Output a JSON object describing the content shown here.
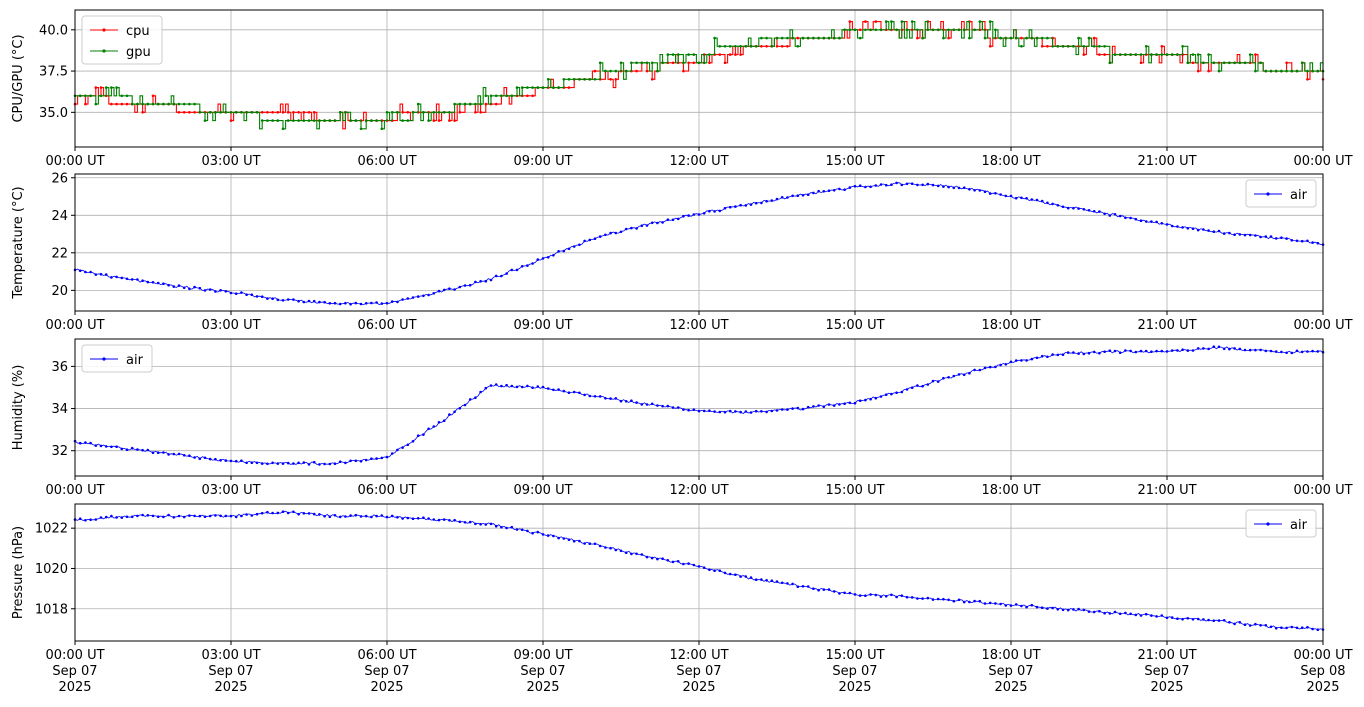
{
  "chart_data": [
    {
      "type": "line",
      "ylabel": "CPU/GPU (°C)",
      "xlabel": "",
      "xlim": [
        "2025-09-07T00:00:00Z",
        "2025-09-08T00:00:00Z"
      ],
      "ylim": [
        32.9,
        41.2
      ],
      "yticks": [
        35.0,
        37.5,
        40.0
      ],
      "ytick_labels": [
        "35.0",
        "37.5",
        "40.0"
      ],
      "xtick_labels": [
        "00:00 UT",
        "03:00 UT",
        "06:00 UT",
        "09:00 UT",
        "12:00 UT",
        "15:00 UT",
        "18:00 UT",
        "21:00 UT",
        "00:00 UT"
      ],
      "grid": true,
      "legend_position": "upper-left",
      "series": [
        {
          "name": "cpu",
          "color": "#ff0000",
          "x_hours": [
            0,
            1,
            2,
            3,
            4,
            5,
            6,
            7,
            8,
            9,
            10,
            11,
            12,
            13,
            14,
            15,
            16,
            17,
            18,
            19,
            20,
            21,
            22,
            23,
            24
          ],
          "y": [
            36.0,
            35.6,
            35.2,
            35.0,
            34.8,
            34.7,
            34.7,
            35.0,
            35.6,
            36.4,
            37.0,
            37.6,
            38.2,
            38.9,
            39.4,
            39.8,
            40.0,
            39.9,
            39.6,
            39.0,
            38.6,
            38.4,
            38.0,
            37.7,
            37.4
          ]
        },
        {
          "name": "gpu",
          "color": "#008000",
          "x_hours": [
            0,
            1,
            2,
            3,
            4,
            5,
            6,
            7,
            8,
            9,
            10,
            11,
            12,
            13,
            14,
            15,
            16,
            17,
            18,
            19,
            20,
            21,
            22,
            23,
            24
          ],
          "y": [
            36.2,
            35.8,
            35.4,
            35.0,
            34.5,
            34.4,
            34.5,
            35.0,
            35.9,
            36.5,
            37.2,
            38.0,
            38.6,
            39.2,
            39.6,
            39.8,
            40.1,
            40.0,
            39.6,
            39.1,
            38.7,
            38.5,
            38.1,
            37.7,
            37.5
          ]
        }
      ]
    },
    {
      "type": "line",
      "ylabel": "Temperature (°C)",
      "xlabel": "",
      "xlim": [
        "2025-09-07T00:00:00Z",
        "2025-09-08T00:00:00Z"
      ],
      "ylim": [
        18.9,
        26.2
      ],
      "yticks": [
        20,
        22,
        24,
        26
      ],
      "ytick_labels": [
        "20",
        "22",
        "24",
        "26"
      ],
      "xtick_labels": [
        "00:00 UT",
        "03:00 UT",
        "06:00 UT",
        "09:00 UT",
        "12:00 UT",
        "15:00 UT",
        "18:00 UT",
        "21:00 UT",
        "00:00 UT"
      ],
      "grid": true,
      "legend_position": "upper-right",
      "series": [
        {
          "name": "air",
          "color": "#0000ff",
          "x_hours": [
            0,
            1,
            2,
            3,
            4,
            5,
            6,
            7,
            8,
            9,
            10,
            11,
            12,
            13,
            14,
            15,
            16,
            17,
            18,
            19,
            20,
            21,
            22,
            23,
            24
          ],
          "y": [
            21.1,
            20.6,
            20.2,
            19.9,
            19.5,
            19.3,
            19.3,
            19.9,
            20.6,
            21.7,
            22.8,
            23.5,
            24.1,
            24.6,
            25.1,
            25.5,
            25.7,
            25.5,
            25.0,
            24.5,
            24.0,
            23.5,
            23.1,
            22.8,
            22.5
          ]
        }
      ]
    },
    {
      "type": "line",
      "ylabel": "Humidity (%)",
      "xlabel": "",
      "xlim": [
        "2025-09-07T00:00:00Z",
        "2025-09-08T00:00:00Z"
      ],
      "ylim": [
        30.8,
        37.3
      ],
      "yticks": [
        32,
        34,
        36
      ],
      "ytick_labels": [
        "32",
        "34",
        "36"
      ],
      "xtick_labels": [
        "00:00 UT",
        "03:00 UT",
        "06:00 UT",
        "09:00 UT",
        "12:00 UT",
        "15:00 UT",
        "18:00 UT",
        "21:00 UT",
        "00:00 UT"
      ],
      "grid": true,
      "legend_position": "upper-left",
      "series": [
        {
          "name": "air",
          "color": "#0000ff",
          "x_hours": [
            0,
            1,
            2,
            3,
            4,
            5,
            6,
            7,
            8,
            9,
            10,
            11,
            12,
            13,
            14,
            15,
            16,
            17,
            18,
            19,
            20,
            21,
            22,
            23,
            24
          ],
          "y": [
            32.4,
            32.1,
            31.8,
            31.5,
            31.4,
            31.4,
            31.7,
            33.3,
            35.1,
            35.0,
            34.6,
            34.2,
            33.9,
            33.8,
            34.0,
            34.3,
            34.9,
            35.6,
            36.2,
            36.6,
            36.7,
            36.7,
            36.9,
            36.7,
            36.7
          ]
        }
      ]
    },
    {
      "type": "line",
      "ylabel": "Pressure (hPa)",
      "xlabel": "",
      "xlim": [
        "2025-09-07T00:00:00Z",
        "2025-09-08T00:00:00Z"
      ],
      "ylim": [
        1016.4,
        1023.2
      ],
      "yticks": [
        1018,
        1020,
        1022
      ],
      "ytick_labels": [
        "1018",
        "1020",
        "1022"
      ],
      "xtick_labels": [
        "00:00 UT\nSep 07\n2025",
        "03:00 UT\nSep 07\n2025",
        "06:00 UT\nSep 07\n2025",
        "09:00 UT\nSep 07\n2025",
        "12:00 UT\nSep 07\n2025",
        "15:00 UT\nSep 07\n2025",
        "18:00 UT\nSep 07\n2025",
        "21:00 UT\nSep 07\n2025",
        "00:00 UT\nSep 08\n2025"
      ],
      "grid": true,
      "legend_position": "upper-right",
      "series": [
        {
          "name": "air",
          "color": "#0000ff",
          "x_hours": [
            0,
            1,
            2,
            3,
            4,
            5,
            6,
            7,
            8,
            9,
            10,
            11,
            12,
            13,
            14,
            15,
            16,
            17,
            18,
            19,
            20,
            21,
            22,
            23,
            24
          ],
          "y": [
            1022.4,
            1022.6,
            1022.6,
            1022.6,
            1022.8,
            1022.6,
            1022.6,
            1022.4,
            1022.2,
            1021.7,
            1021.2,
            1020.6,
            1020.1,
            1019.5,
            1019.1,
            1018.7,
            1018.6,
            1018.4,
            1018.2,
            1018.0,
            1017.8,
            1017.6,
            1017.4,
            1017.1,
            1017.0
          ]
        }
      ]
    }
  ]
}
